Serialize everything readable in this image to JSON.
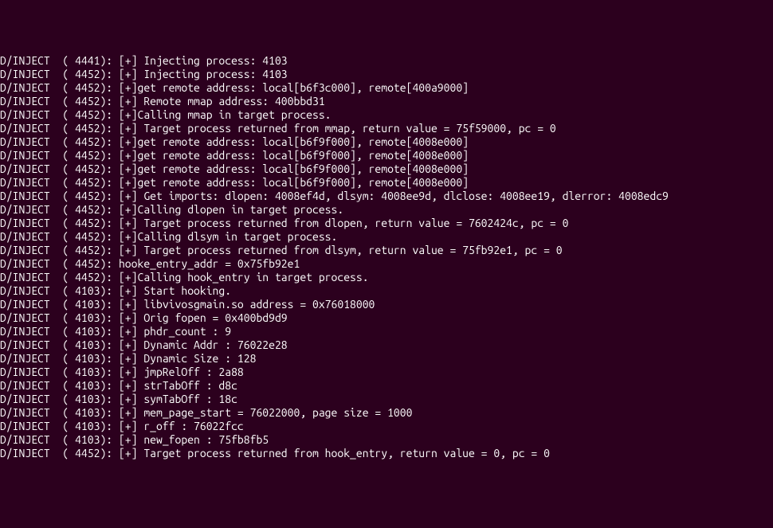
{
  "log_lines": [
    "D/INJECT  ( 4441): [+] Injecting process: 4103",
    "D/INJECT  ( 4452): [+] Injecting process: 4103",
    "D/INJECT  ( 4452): [+]get remote address: local[b6f3c000], remote[400a9000]",
    "D/INJECT  ( 4452): [+] Remote mmap address: 400bbd31",
    "D/INJECT  ( 4452): [+]Calling mmap in target process.",
    "D/INJECT  ( 4452): [+] Target process returned from mmap, return value = 75f59000, pc = 0",
    "D/INJECT  ( 4452): [+]get remote address: local[b6f9f000], remote[4008e000]",
    "D/INJECT  ( 4452): [+]get remote address: local[b6f9f000], remote[4008e000]",
    "D/INJECT  ( 4452): [+]get remote address: local[b6f9f000], remote[4008e000]",
    "D/INJECT  ( 4452): [+]get remote address: local[b6f9f000], remote[4008e000]",
    "D/INJECT  ( 4452): [+] Get imports: dlopen: 4008ef4d, dlsym: 4008ee9d, dlclose: 4008ee19, dlerror: 4008edc9",
    "D/INJECT  ( 4452): [+]Calling dlopen in target process.",
    "D/INJECT  ( 4452): [+] Target process returned from dlopen, return value = 7602424c, pc = 0",
    "D/INJECT  ( 4452): [+]Calling dlsym in target process.",
    "D/INJECT  ( 4452): [+] Target process returned from dlsym, return value = 75fb92e1, pc = 0",
    "D/INJECT  ( 4452): hooke_entry_addr = 0x75fb92e1",
    "D/INJECT  ( 4452): [+]Calling hook_entry in target process.",
    "D/INJECT  ( 4103): [+] Start hooking.",
    "D/INJECT  ( 4103): [+] libvivosgmain.so address = 0x76018000",
    "D/INJECT  ( 4103): [+] Orig fopen = 0x400bd9d9",
    "D/INJECT  ( 4103): [+] phdr_count : 9",
    "D/INJECT  ( 4103): [+] Dynamic Addr : 76022e28",
    "D/INJECT  ( 4103): [+] Dynamic Size : 128",
    "D/INJECT  ( 4103): [+] jmpRelOff : 2a88",
    "D/INJECT  ( 4103): [+] strTabOff : d8c",
    "D/INJECT  ( 4103): [+] symTabOff : 18c",
    "D/INJECT  ( 4103): [+] mem_page_start = 76022000, page size = 1000",
    "D/INJECT  ( 4103): [+] r_off : 76022fcc",
    "D/INJECT  ( 4103): [+] new_fopen : 75fb8fb5",
    "D/INJECT  ( 4452): [+] Target process returned from hook_entry, return value = 0, pc = 0"
  ]
}
